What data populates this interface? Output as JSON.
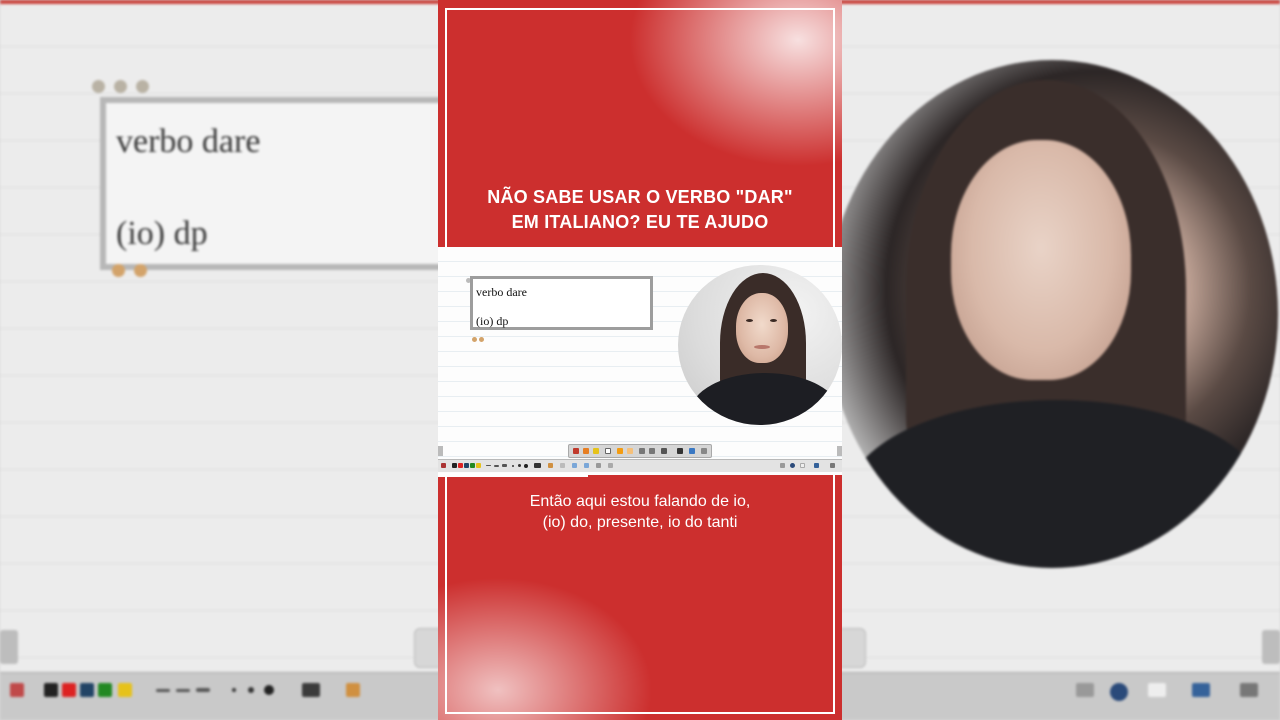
{
  "headline": {
    "line1": "NÃO SABE USAR O VERBO \"DAR\"",
    "line2": "EM ITALIANO? EU TE AJUDO"
  },
  "whiteboard": {
    "line1": "verbo dare",
    "line2": "(io) dp"
  },
  "subtitle": {
    "line1": "Então aqui estou falando de io,",
    "line2": "(io) do, presente, io do tanti"
  },
  "colors": {
    "accent_red": "#cc2f2e",
    "frame": "#ffffff"
  }
}
